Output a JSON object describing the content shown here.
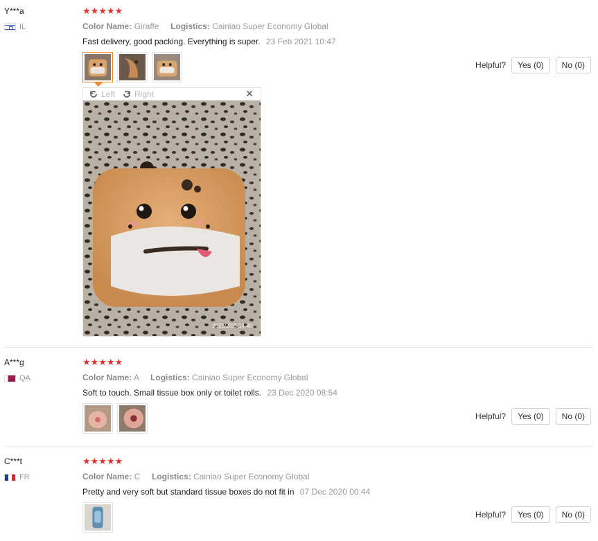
{
  "reviews": [
    {
      "user": "Y***a",
      "country": "IL",
      "rating": 5,
      "stars": "★★★★★",
      "color_label": "Color Name:",
      "color_value": "Giraffe",
      "logistics_label": "Logistics:",
      "logistics_value": "Cainiao Super Economy Global",
      "text": "Fast delivery, good packing. Everything is super.",
      "date": "23 Feb 2021 10:47",
      "helpful_label": "Helpful?",
      "yes_label": "Yes (0)",
      "no_label": "No (0)",
      "photos": [
        "giraffe-box-front",
        "giraffe-box-side",
        "giraffe-box-top"
      ]
    },
    {
      "user": "A***g",
      "country": "QA",
      "rating": 5,
      "stars": "★★★★★",
      "color_label": "Color Name:",
      "color_value": "A",
      "logistics_label": "Logistics:",
      "logistics_value": "Cainiao Super Economy Global",
      "text": "Soft to touch. Small tissue box only or toilet rolls.",
      "date": "23 Dec 2020 08:54",
      "helpful_label": "Helpful?",
      "yes_label": "Yes (0)",
      "no_label": "No (0)",
      "photos": [
        "pink-plush-a",
        "pink-plush-b"
      ]
    },
    {
      "user": "C***t",
      "country": "FR",
      "rating": 4.5,
      "stars": "★★★★★",
      "color_label": "Color Name:",
      "color_value": "C",
      "logistics_label": "Logistics:",
      "logistics_value": "Cainiao Super Economy Global",
      "text": "Pretty and very soft but standard tissue boxes do not fit in",
      "date": "07 Dec 2020 00:44",
      "helpful_label": "Helpful?",
      "yes_label": "Yes (0)",
      "no_label": "No (0)",
      "photos": [
        "blue-plush"
      ]
    }
  ],
  "viewer": {
    "left_label": "Left",
    "right_label": "Right",
    "close_icon": "close-icon",
    "photo_timestamp": "2021/2/23 14:40",
    "photo_subject": "giraffe-tissue-box-on-leopard-blanket"
  },
  "colors": {
    "star": "#e62e2e",
    "active_thumb_border": "#f08a24",
    "divider": "#e8e8e8"
  }
}
